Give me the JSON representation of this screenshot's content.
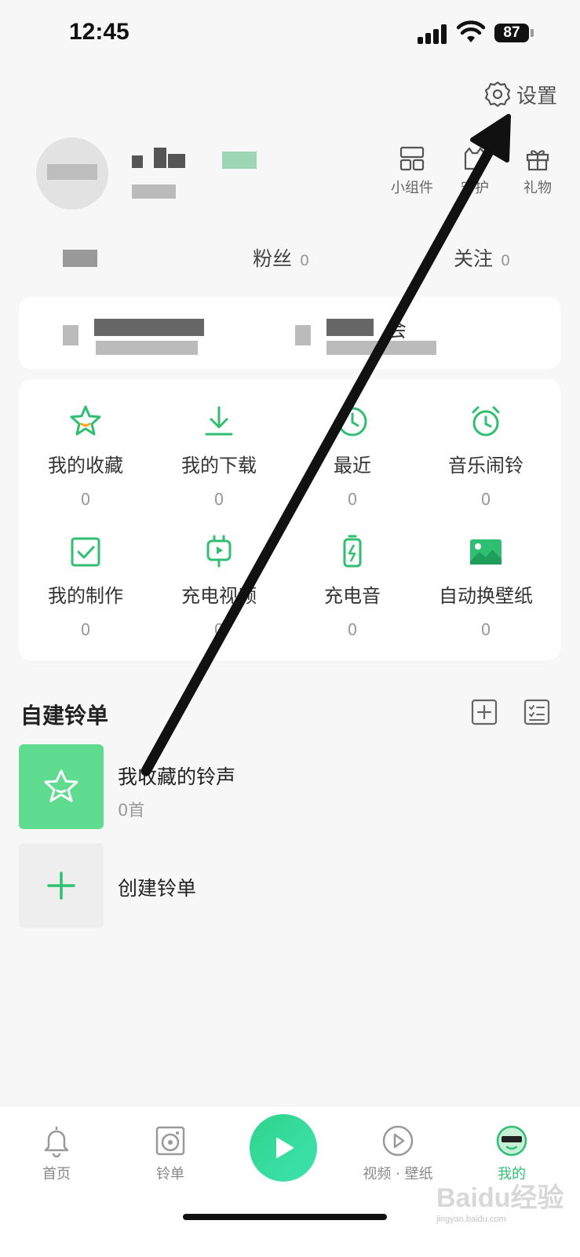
{
  "status": {
    "time": "12:45",
    "battery": "87"
  },
  "header": {
    "settings_label": "设置"
  },
  "quick_actions": [
    {
      "label": "小组件",
      "icon": "widget-icon"
    },
    {
      "label": "守护",
      "icon": "cat-guard-icon"
    },
    {
      "label": "礼物",
      "icon": "gift-icon"
    }
  ],
  "stats": {
    "fans_label": "粉丝",
    "fans_count": "0",
    "follow_label": "关注",
    "follow_count": "0"
  },
  "vip": {
    "right_suffix": "会"
  },
  "features": [
    {
      "label": "我的收藏",
      "count": "0",
      "icon": "star-icon"
    },
    {
      "label": "我的下载",
      "count": "0",
      "icon": "download-icon"
    },
    {
      "label": "最近",
      "count": "0",
      "icon": "clock-icon"
    },
    {
      "label": "音乐闹铃",
      "count": "0",
      "icon": "alarm-icon"
    },
    {
      "label": "我的制作",
      "count": "0",
      "icon": "edit-check-icon"
    },
    {
      "label": "充电视频",
      "count": "0",
      "icon": "charge-video-icon"
    },
    {
      "label": "充电音",
      "count": "0",
      "icon": "battery-icon"
    },
    {
      "label": "自动换壁纸",
      "count": "0",
      "icon": "image-icon"
    }
  ],
  "playlists": {
    "section_title": "自建铃单",
    "items": [
      {
        "title": "我收藏的铃声",
        "sub": "0首"
      },
      {
        "title": "创建铃单"
      }
    ]
  },
  "tabbar": [
    {
      "label": "首页",
      "icon": "bell-icon"
    },
    {
      "label": "铃单",
      "icon": "disc-icon"
    },
    {
      "label": "视频 · 壁纸",
      "icon": "video-icon"
    },
    {
      "label": "我的",
      "icon": "avatar-icon"
    }
  ],
  "watermark": {
    "brand": "Baidu经验",
    "url": "jingyan.baidu.com"
  },
  "colors": {
    "accent": "#2fbf71",
    "card": "#ffffff",
    "background": "#f7f7f7"
  }
}
